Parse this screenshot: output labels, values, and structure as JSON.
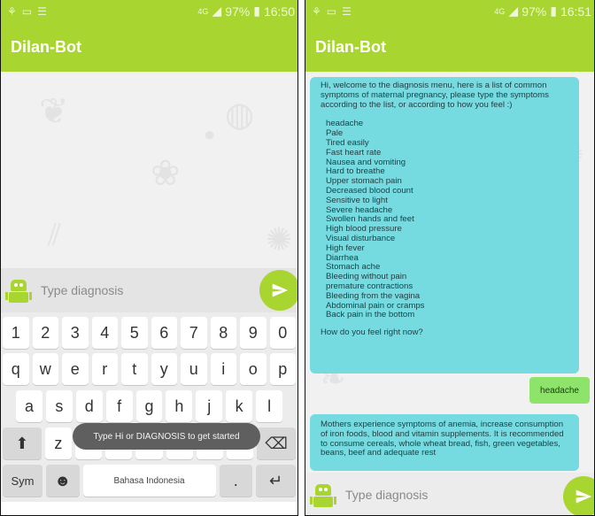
{
  "left": {
    "status": {
      "battery": "97%",
      "time": "16:50",
      "network": "4G"
    },
    "toolbar": {
      "title": "Dilan-Bot"
    },
    "input": {
      "placeholder": "Type diagnosis"
    },
    "keyboard": {
      "row1": [
        "1",
        "2",
        "3",
        "4",
        "5",
        "6",
        "7",
        "8",
        "9",
        "0"
      ],
      "row2": [
        "q",
        "w",
        "e",
        "r",
        "t",
        "y",
        "u",
        "i",
        "o",
        "p"
      ],
      "row3": [
        "a",
        "s",
        "d",
        "f",
        "g",
        "h",
        "j",
        "k",
        "l"
      ],
      "row4": [
        "z",
        "x",
        "c",
        "v",
        "b",
        "n",
        "m"
      ],
      "sym_label": "Sym",
      "space_label": "Bahasa Indonesia",
      "period_label": "."
    },
    "toast": "Type Hi or DIAGNOSIS to get started"
  },
  "right": {
    "status": {
      "battery": "97%",
      "time": "16:51",
      "network": "4G"
    },
    "toolbar": {
      "title": "Dilan-Bot"
    },
    "input": {
      "placeholder": "Type diagnosis"
    },
    "bot_message_1": {
      "intro": "Hi, welcome to the diagnosis menu, here is a list of common symptoms of maternal pregnancy, please type the symptoms according to the list, or according to how you feel :)",
      "symptoms": [
        "headache",
        "Pale",
        "Tired easily",
        "Fast heart rate",
        "Nausea and vomiting",
        "Hard to breathe",
        "Upper stomach pain",
        "Decreased blood count",
        "Sensitive to light",
        "Severe headache",
        "Swollen hands and feet",
        "High blood pressure",
        "Visual disturbance",
        "High fever",
        "Diarrhea",
        "Stomach ache",
        "Bleeding without pain",
        "premature contractions",
        "Bleeding from the vagina",
        "Abdominal pain or cramps",
        "Back pain in the bottom"
      ],
      "question": "How do you feel right now?"
    },
    "user_message": "headache",
    "bot_message_2": "Mothers experience symptoms of anemia, increase consumption of iron foods, blood and vitamin supplements. It is recommended to consume cereals, whole wheat bread, fish, green vegetables, beans, beef and adequate rest"
  },
  "colors": {
    "accent": "#a8d52f",
    "bot_bubble": "#75dbe0",
    "user_bubble": "#8ee36b"
  }
}
